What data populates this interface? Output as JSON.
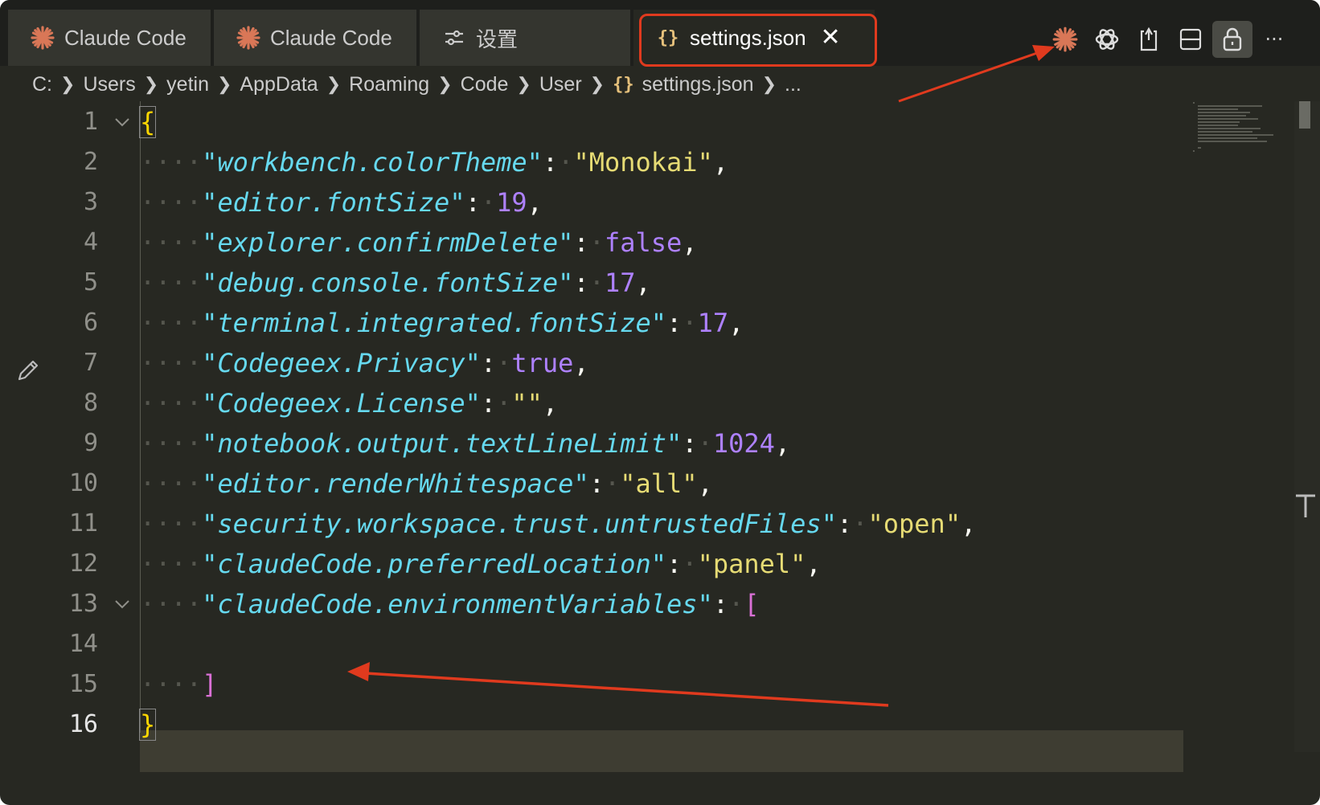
{
  "tabs": [
    {
      "label": "Claude Code",
      "icon": "claude-asterisk-icon"
    },
    {
      "label": "Claude Code",
      "icon": "claude-asterisk-icon"
    },
    {
      "label": "设置",
      "icon": "settings-sliders-icon"
    },
    {
      "label": "settings.json",
      "icon": "json-braces-icon",
      "icon_text": "{}",
      "active": true,
      "close": "✕"
    }
  ],
  "actions": [
    "claude-asterisk-icon",
    "openai-icon",
    "open-changes-icon",
    "split-editor-icon",
    "lock-icon",
    "more-icon"
  ],
  "actions_more": "···",
  "breadcrumb": {
    "items": [
      "C:",
      "Users",
      "yetin",
      "AppData",
      "Roaming",
      "Code",
      "User",
      "settings.json",
      "..."
    ],
    "file_icon_text": "{}"
  },
  "editor": {
    "line_numbers": [
      "1",
      "2",
      "3",
      "4",
      "5",
      "6",
      "7",
      "8",
      "9",
      "10",
      "11",
      "12",
      "13",
      "14",
      "15",
      "16"
    ],
    "current_line": 16,
    "ws4": "····",
    "open_brace": "{",
    "close_brace": "}",
    "open_bracket": "[",
    "close_bracket": "]",
    "entries": [
      {
        "key": "\"workbench.colorTheme\"",
        "value": "\"Monokai\"",
        "type": "string"
      },
      {
        "key": "\"editor.fontSize\"",
        "value": "19",
        "type": "number"
      },
      {
        "key": "\"explorer.confirmDelete\"",
        "value": "false",
        "type": "keyword"
      },
      {
        "key": "\"debug.console.fontSize\"",
        "value": "17",
        "type": "number"
      },
      {
        "key": "\"terminal.integrated.fontSize\"",
        "value": "17",
        "type": "number"
      },
      {
        "key": "\"Codegeex.Privacy\"",
        "value": "true",
        "type": "keyword"
      },
      {
        "key": "\"Codegeex.License\"",
        "value": "\"\"",
        "type": "string"
      },
      {
        "key": "\"notebook.output.textLineLimit\"",
        "value": "1024",
        "type": "number"
      },
      {
        "key": "\"editor.renderWhitespace\"",
        "value": "\"all\"",
        "type": "string"
      },
      {
        "key": "\"security.workspace.trust.untrustedFiles\"",
        "value": "\"open\"",
        "type": "string"
      },
      {
        "key": "\"claudeCode.preferredLocation\"",
        "value": "\"panel\"",
        "type": "string"
      },
      {
        "key": "\"claudeCode.environmentVariables\"",
        "value": "[",
        "type": "bracket"
      }
    ],
    "colon": ":",
    "comma": ","
  },
  "colors": {
    "background": "#272822",
    "tabbar": "#1e1f1c",
    "key": "#66d9ef",
    "string": "#e6db74",
    "number": "#ae81ff",
    "annotation": "#e03a1e",
    "claude_orange": "#d97757"
  }
}
